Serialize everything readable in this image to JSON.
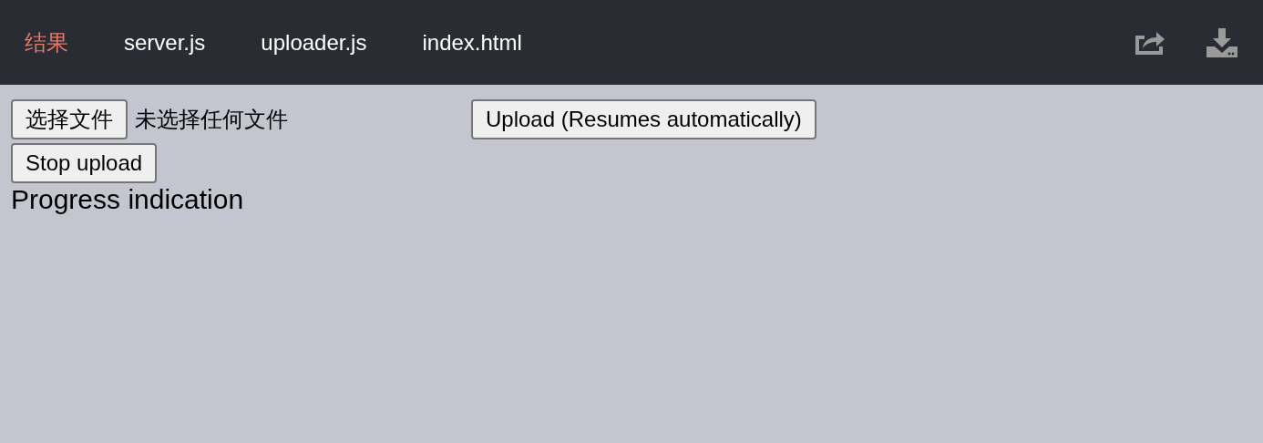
{
  "tabs": [
    {
      "label": "结果",
      "selected": true
    },
    {
      "label": "server.js",
      "selected": false
    },
    {
      "label": "uploader.js",
      "selected": false
    },
    {
      "label": "index.html",
      "selected": false
    }
  ],
  "toolbar_icons": [
    {
      "kind": "share"
    },
    {
      "kind": "download"
    }
  ],
  "file_input": {
    "button": "选择文件",
    "status": "未选择任何文件"
  },
  "upload_button": "Upload (Resumes automatically)",
  "stop_button": "Stop upload",
  "progress_text": "Progress indication"
}
